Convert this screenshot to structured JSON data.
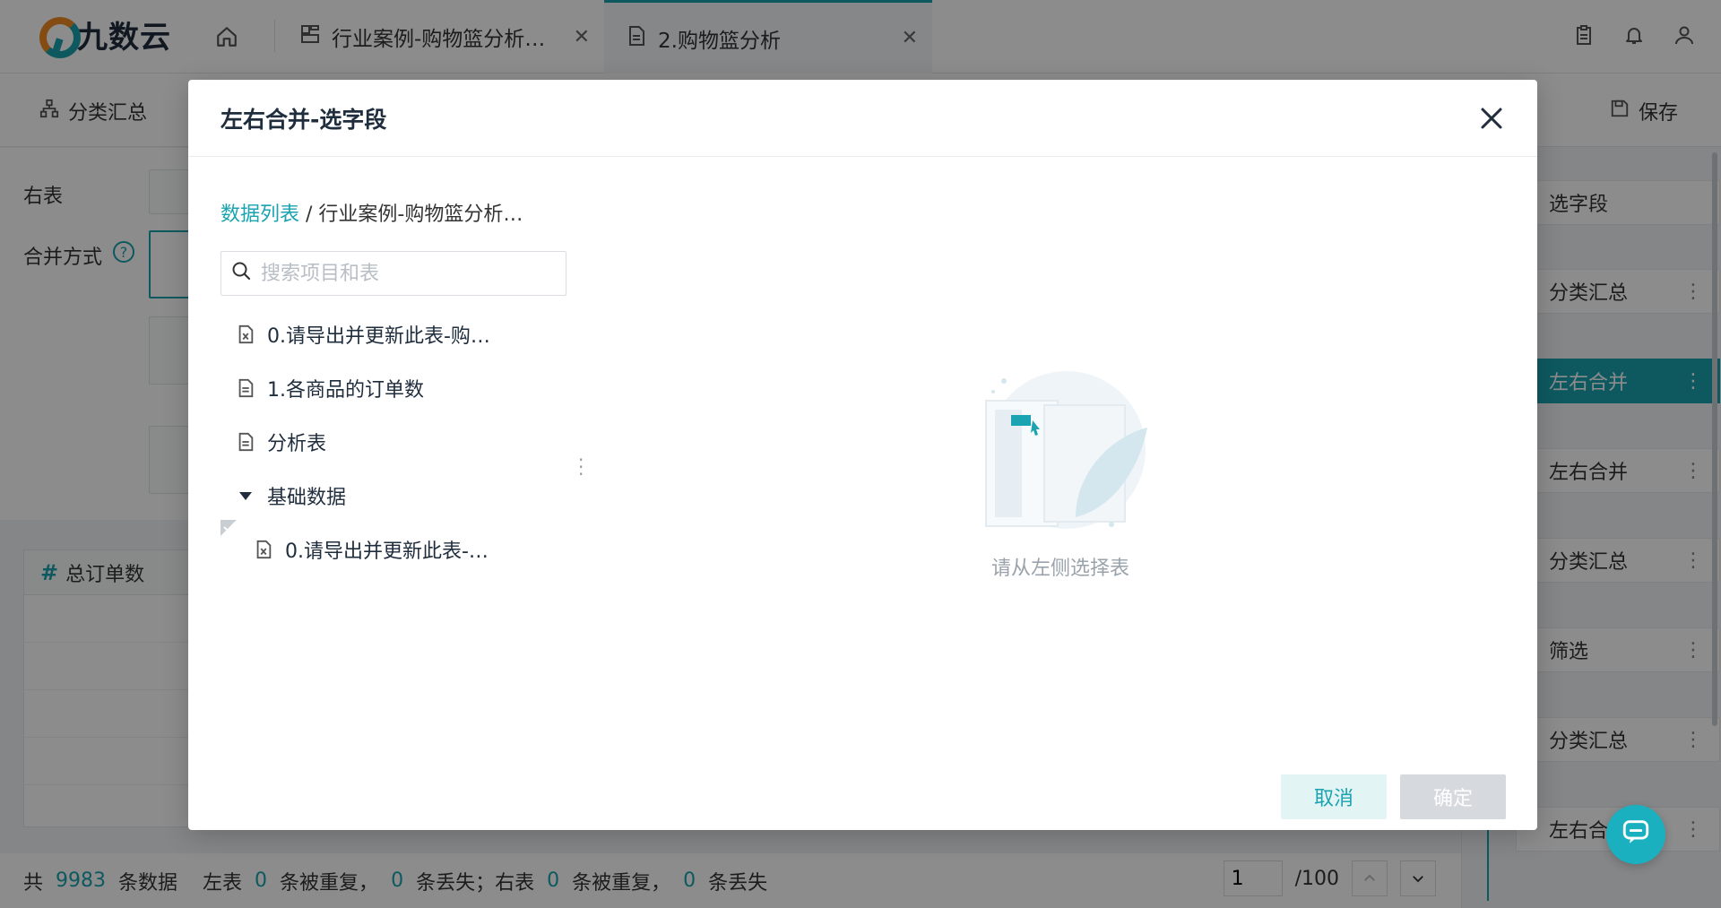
{
  "app": {
    "logo_text": "九数云"
  },
  "tabs": [
    {
      "label": "行业案例-购物篮分析…"
    },
    {
      "label": "2.购物篮分析"
    }
  ],
  "toolbar": {
    "summary_label": "分类汇总",
    "save_label": "保存"
  },
  "background": {
    "right_table_label": "右表",
    "merge_mode_label": "合并方式",
    "column_header": "总订单数"
  },
  "steps": [
    {
      "label": "选字段"
    },
    {
      "label": "分类汇总"
    },
    {
      "label": "左右合并"
    },
    {
      "label": "左右合并"
    },
    {
      "label": "分类汇总"
    },
    {
      "label": "筛选"
    },
    {
      "label": "分类汇总"
    },
    {
      "label": "左右合并"
    }
  ],
  "footer": {
    "prefix": "共",
    "row_count": "9983",
    "rows_suffix": "条数据",
    "left_label": "左表",
    "left_dup": "0",
    "dup_suffix": "条被重复，",
    "left_lost": "0",
    "lost_suffix_1": "条丢失；右表",
    "right_dup": "0",
    "dup_suffix_2": "条被重复，",
    "right_lost": "0",
    "lost_suffix_2": "条丢失"
  },
  "pager": {
    "current": "1",
    "total": "/100"
  },
  "modal": {
    "title": "左右合并-选字段",
    "breadcrumb_link": "数据列表",
    "breadcrumb_sep": " / ",
    "breadcrumb_current": "行业案例-购物篮分析…",
    "search_placeholder": "搜索项目和表",
    "tree": [
      {
        "label": "0.请导出并更新此表-购…",
        "icon": "excel-table-icon"
      },
      {
        "label": "1.各商品的订单数",
        "icon": "table-icon"
      },
      {
        "label": "分析表",
        "icon": "table-icon"
      },
      {
        "label": "基础数据",
        "icon": "caret-down-icon"
      },
      {
        "label": "0.请导出并更新此表-…",
        "icon": "excel-table-icon"
      }
    ],
    "empty_text": "请从左侧选择表",
    "cancel_label": "取消",
    "ok_label": "确定"
  },
  "colors": {
    "accent": "#1aa3b0",
    "disabled": "#d6d9dd"
  }
}
